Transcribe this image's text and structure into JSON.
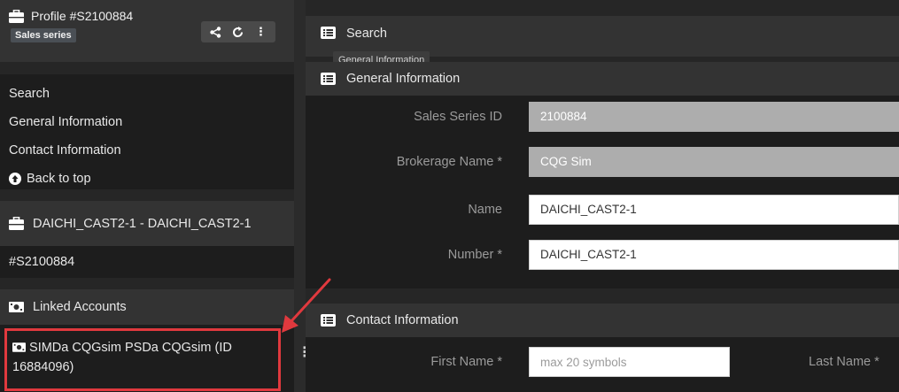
{
  "sidebar": {
    "profile": {
      "title": "Profile #S2100884",
      "badge": "Sales series",
      "toolbar": {
        "share_icon": "share-icon",
        "refresh_icon": "refresh-icon",
        "menu_icon": "vertical-dots-icon",
        "share_glyph": "<",
        "refresh_glyph": "↻",
        "menu_glyph": "⋮"
      }
    },
    "nav": {
      "items": [
        "Search",
        "General Information",
        "Contact Information"
      ],
      "back_to_top": "Back to top"
    },
    "account": {
      "title": "DAICHI_CAST2-1 - DAICHI_CAST2-1",
      "id": "#S2100884"
    },
    "linked": {
      "title": "Linked Accounts",
      "item_line1": "SIMDa CQGsim PSDa CQGsim (ID",
      "item_line2": "16884096)",
      "kebab": "⋮"
    }
  },
  "main": {
    "search": {
      "title": "Search",
      "tooltip": "General Information"
    },
    "general": {
      "title": "General Information",
      "fields": [
        {
          "label": "Sales Series ID",
          "value": "2100884",
          "readonly": true
        },
        {
          "label": "Brokerage Name *",
          "value": "CQG Sim",
          "readonly": true
        },
        {
          "label": "Name",
          "value": "DAICHI_CAST2-1",
          "readonly": false
        },
        {
          "label": "Number *",
          "value": "DAICHI_CAST2-1",
          "readonly": false
        }
      ]
    },
    "contact": {
      "title": "Contact Information",
      "first_name_label": "First Name *",
      "first_name_placeholder": "max 20 symbols",
      "last_name_label": "Last Name *"
    }
  },
  "colors": {
    "highlight": "#e0393e",
    "arrow": "#e0393e",
    "background": "#2b2b2b"
  }
}
